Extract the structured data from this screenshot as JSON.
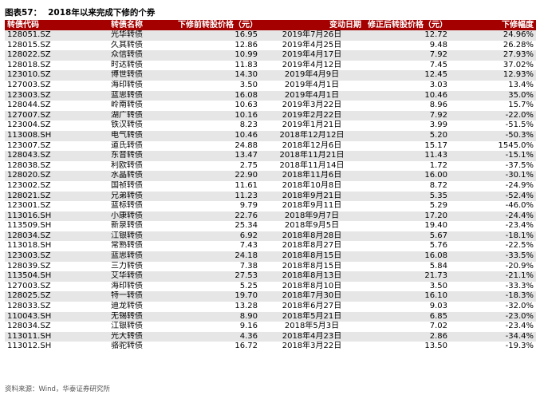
{
  "figure": {
    "label": "图表57：",
    "title": "2018年以来完成下修的个券"
  },
  "columns": [
    "转债代码",
    "转债名称",
    "下修前转股价格（元）",
    "变动日期",
    "修正后转股价格（元）",
    "下修幅度"
  ],
  "rows": [
    {
      "code": "128051.SZ",
      "name": "光华转债",
      "pre": "16.95",
      "date": "2019年7月26日",
      "post": "12.72",
      "pct": "24.96%"
    },
    {
      "code": "128015.SZ",
      "name": "久其转债",
      "pre": "12.86",
      "date": "2019年4月25日",
      "post": "9.48",
      "pct": "26.28%"
    },
    {
      "code": "128022.SZ",
      "name": "众信转债",
      "pre": "10.99",
      "date": "2019年4月17日",
      "post": "7.92",
      "pct": "27.93%"
    },
    {
      "code": "128018.SZ",
      "name": "时达转债",
      "pre": "11.83",
      "date": "2019年4月12日",
      "post": "7.45",
      "pct": "37.02%"
    },
    {
      "code": "123010.SZ",
      "name": "博世转债",
      "pre": "14.30",
      "date": "2019年4月9日",
      "post": "12.45",
      "pct": "12.93%"
    },
    {
      "code": "127003.SZ",
      "name": "海印转债",
      "pre": "3.50",
      "date": "2019年4月1日",
      "post": "3.03",
      "pct": "13.4%"
    },
    {
      "code": "123003.SZ",
      "name": "蓝思转债",
      "pre": "16.08",
      "date": "2019年4月1日",
      "post": "10.46",
      "pct": "35.0%"
    },
    {
      "code": "128044.SZ",
      "name": "岭南转债",
      "pre": "10.63",
      "date": "2019年3月22日",
      "post": "8.96",
      "pct": "15.7%"
    },
    {
      "code": "127007.SZ",
      "name": "湖广转债",
      "pre": "10.16",
      "date": "2019年2月22日",
      "post": "7.92",
      "pct": "-22.0%"
    },
    {
      "code": "123004.SZ",
      "name": "铁汉转债",
      "pre": "8.23",
      "date": "2019年1月21日",
      "post": "3.99",
      "pct": "-51.5%"
    },
    {
      "code": "113008.SH",
      "name": "电气转债",
      "pre": "10.46",
      "date": "2018年12月12日",
      "post": "5.20",
      "pct": "-50.3%"
    },
    {
      "code": "123007.SZ",
      "name": "道氏转债",
      "pre": "24.88",
      "date": "2018年12月6日",
      "post": "15.17",
      "pct": "1545.0%"
    },
    {
      "code": "128043.SZ",
      "name": "东音转债",
      "pre": "13.47",
      "date": "2018年11月21日",
      "post": "11.43",
      "pct": "-15.1%"
    },
    {
      "code": "128038.SZ",
      "name": "利欧转债",
      "pre": "2.75",
      "date": "2018年11月14日",
      "post": "1.72",
      "pct": "-37.5%"
    },
    {
      "code": "128020.SZ",
      "name": "水晶转债",
      "pre": "22.90",
      "date": "2018年11月6日",
      "post": "16.00",
      "pct": "-30.1%"
    },
    {
      "code": "123002.SZ",
      "name": "国祯转债",
      "pre": "11.61",
      "date": "2018年10月8日",
      "post": "8.72",
      "pct": "-24.9%"
    },
    {
      "code": "128021.SZ",
      "name": "兄弟转债",
      "pre": "11.23",
      "date": "2018年9月21日",
      "post": "5.35",
      "pct": "-52.4%"
    },
    {
      "code": "123001.SZ",
      "name": "蓝标转债",
      "pre": "9.79",
      "date": "2018年9月11日",
      "post": "5.29",
      "pct": "-46.0%"
    },
    {
      "code": "113016.SH",
      "name": "小康转债",
      "pre": "22.76",
      "date": "2018年9月7日",
      "post": "17.20",
      "pct": "-24.4%"
    },
    {
      "code": "113509.SH",
      "name": "新泉转债",
      "pre": "25.34",
      "date": "2018年9月5日",
      "post": "19.40",
      "pct": "-23.4%"
    },
    {
      "code": "128034.SZ",
      "name": "江银转债",
      "pre": "6.92",
      "date": "2018年8月28日",
      "post": "5.67",
      "pct": "-18.1%"
    },
    {
      "code": "113018.SH",
      "name": "常熟转债",
      "pre": "7.43",
      "date": "2018年8月27日",
      "post": "5.76",
      "pct": "-22.5%"
    },
    {
      "code": "123003.SZ",
      "name": "蓝思转债",
      "pre": "24.18",
      "date": "2018年8月15日",
      "post": "16.08",
      "pct": "-33.5%"
    },
    {
      "code": "128039.SZ",
      "name": "三力转债",
      "pre": "7.38",
      "date": "2018年8月15日",
      "post": "5.84",
      "pct": "-20.9%"
    },
    {
      "code": "113504.SH",
      "name": "艾华转债",
      "pre": "27.53",
      "date": "2018年8月13日",
      "post": "21.73",
      "pct": "-21.1%"
    },
    {
      "code": "127003.SZ",
      "name": "海印转债",
      "pre": "5.25",
      "date": "2018年8月10日",
      "post": "3.50",
      "pct": "-33.3%"
    },
    {
      "code": "128025.SZ",
      "name": "特一转债",
      "pre": "19.70",
      "date": "2018年7月30日",
      "post": "16.10",
      "pct": "-18.3%"
    },
    {
      "code": "128033.SZ",
      "name": "迪龙转债",
      "pre": "13.28",
      "date": "2018年6月27日",
      "post": "9.03",
      "pct": "-32.0%"
    },
    {
      "code": "110043.SH",
      "name": "无锡转债",
      "pre": "8.90",
      "date": "2018年5月21日",
      "post": "6.85",
      "pct": "-23.0%"
    },
    {
      "code": "128034.SZ",
      "name": "江银转债",
      "pre": "9.16",
      "date": "2018年5月3日",
      "post": "7.02",
      "pct": "-23.4%"
    },
    {
      "code": "113011.SH",
      "name": "光大转债",
      "pre": "4.36",
      "date": "2018年4月23日",
      "post": "2.86",
      "pct": "-34.4%"
    },
    {
      "code": "113012.SH",
      "name": "骆驼转债",
      "pre": "16.72",
      "date": "2018年3月22日",
      "post": "13.50",
      "pct": "-19.3%"
    }
  ],
  "source": "资料来源：Wind，华泰证券研究所",
  "colors": {
    "header_bg": "#a40000",
    "header_text": "#ffffff",
    "stripe": "#e6e6e6"
  }
}
